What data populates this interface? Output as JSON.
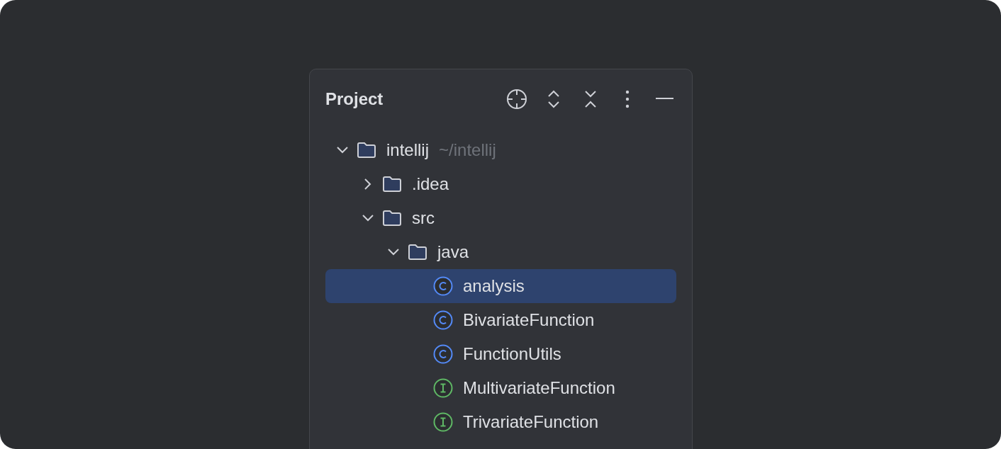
{
  "panel": {
    "title": "Project"
  },
  "tree": [
    {
      "kind": "folder",
      "label": "intellij",
      "path": "~/intellij",
      "expanded": true,
      "selected": false,
      "children": [
        {
          "kind": "folder",
          "label": ".idea",
          "expanded": false,
          "selected": false
        },
        {
          "kind": "folder",
          "label": "src",
          "expanded": true,
          "selected": false,
          "children": [
            {
              "kind": "folder",
              "label": "java",
              "expanded": true,
              "selected": false,
              "children": [
                {
                  "kind": "class",
                  "label": "analysis",
                  "selected": true
                },
                {
                  "kind": "class",
                  "label": "BivariateFunction",
                  "selected": false
                },
                {
                  "kind": "class",
                  "label": "FunctionUtils",
                  "selected": false
                },
                {
                  "kind": "interface",
                  "label": "MultivariateFunction",
                  "selected": false
                },
                {
                  "kind": "interface",
                  "label": "TrivariateFunction",
                  "selected": false
                }
              ]
            }
          ]
        }
      ]
    }
  ]
}
